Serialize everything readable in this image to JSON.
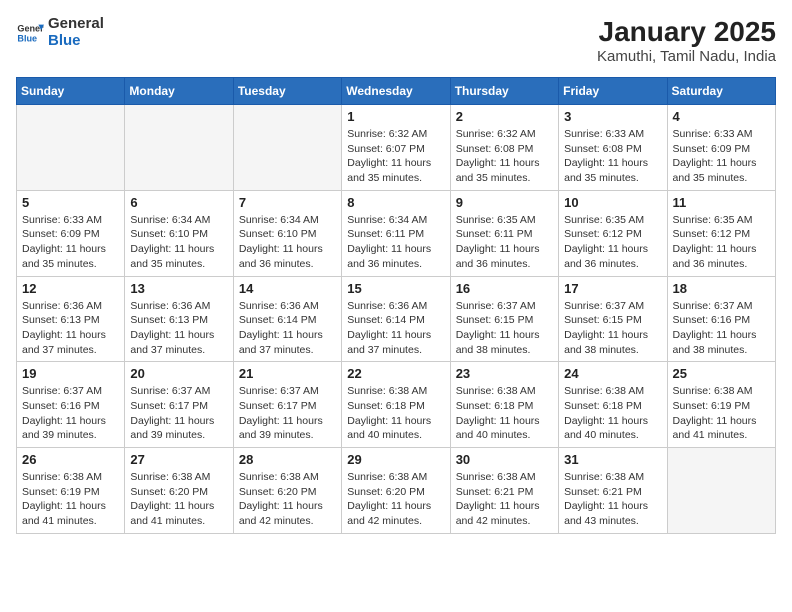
{
  "header": {
    "logo_line1": "General",
    "logo_line2": "Blue",
    "month": "January 2025",
    "location": "Kamuthi, Tamil Nadu, India"
  },
  "weekdays": [
    "Sunday",
    "Monday",
    "Tuesday",
    "Wednesday",
    "Thursday",
    "Friday",
    "Saturday"
  ],
  "weeks": [
    [
      {
        "day": "",
        "info": ""
      },
      {
        "day": "",
        "info": ""
      },
      {
        "day": "",
        "info": ""
      },
      {
        "day": "1",
        "info": "Sunrise: 6:32 AM\nSunset: 6:07 PM\nDaylight: 11 hours and 35 minutes."
      },
      {
        "day": "2",
        "info": "Sunrise: 6:32 AM\nSunset: 6:08 PM\nDaylight: 11 hours and 35 minutes."
      },
      {
        "day": "3",
        "info": "Sunrise: 6:33 AM\nSunset: 6:08 PM\nDaylight: 11 hours and 35 minutes."
      },
      {
        "day": "4",
        "info": "Sunrise: 6:33 AM\nSunset: 6:09 PM\nDaylight: 11 hours and 35 minutes."
      }
    ],
    [
      {
        "day": "5",
        "info": "Sunrise: 6:33 AM\nSunset: 6:09 PM\nDaylight: 11 hours and 35 minutes."
      },
      {
        "day": "6",
        "info": "Sunrise: 6:34 AM\nSunset: 6:10 PM\nDaylight: 11 hours and 35 minutes."
      },
      {
        "day": "7",
        "info": "Sunrise: 6:34 AM\nSunset: 6:10 PM\nDaylight: 11 hours and 36 minutes."
      },
      {
        "day": "8",
        "info": "Sunrise: 6:34 AM\nSunset: 6:11 PM\nDaylight: 11 hours and 36 minutes."
      },
      {
        "day": "9",
        "info": "Sunrise: 6:35 AM\nSunset: 6:11 PM\nDaylight: 11 hours and 36 minutes."
      },
      {
        "day": "10",
        "info": "Sunrise: 6:35 AM\nSunset: 6:12 PM\nDaylight: 11 hours and 36 minutes."
      },
      {
        "day": "11",
        "info": "Sunrise: 6:35 AM\nSunset: 6:12 PM\nDaylight: 11 hours and 36 minutes."
      }
    ],
    [
      {
        "day": "12",
        "info": "Sunrise: 6:36 AM\nSunset: 6:13 PM\nDaylight: 11 hours and 37 minutes."
      },
      {
        "day": "13",
        "info": "Sunrise: 6:36 AM\nSunset: 6:13 PM\nDaylight: 11 hours and 37 minutes."
      },
      {
        "day": "14",
        "info": "Sunrise: 6:36 AM\nSunset: 6:14 PM\nDaylight: 11 hours and 37 minutes."
      },
      {
        "day": "15",
        "info": "Sunrise: 6:36 AM\nSunset: 6:14 PM\nDaylight: 11 hours and 37 minutes."
      },
      {
        "day": "16",
        "info": "Sunrise: 6:37 AM\nSunset: 6:15 PM\nDaylight: 11 hours and 38 minutes."
      },
      {
        "day": "17",
        "info": "Sunrise: 6:37 AM\nSunset: 6:15 PM\nDaylight: 11 hours and 38 minutes."
      },
      {
        "day": "18",
        "info": "Sunrise: 6:37 AM\nSunset: 6:16 PM\nDaylight: 11 hours and 38 minutes."
      }
    ],
    [
      {
        "day": "19",
        "info": "Sunrise: 6:37 AM\nSunset: 6:16 PM\nDaylight: 11 hours and 39 minutes."
      },
      {
        "day": "20",
        "info": "Sunrise: 6:37 AM\nSunset: 6:17 PM\nDaylight: 11 hours and 39 minutes."
      },
      {
        "day": "21",
        "info": "Sunrise: 6:37 AM\nSunset: 6:17 PM\nDaylight: 11 hours and 39 minutes."
      },
      {
        "day": "22",
        "info": "Sunrise: 6:38 AM\nSunset: 6:18 PM\nDaylight: 11 hours and 40 minutes."
      },
      {
        "day": "23",
        "info": "Sunrise: 6:38 AM\nSunset: 6:18 PM\nDaylight: 11 hours and 40 minutes."
      },
      {
        "day": "24",
        "info": "Sunrise: 6:38 AM\nSunset: 6:18 PM\nDaylight: 11 hours and 40 minutes."
      },
      {
        "day": "25",
        "info": "Sunrise: 6:38 AM\nSunset: 6:19 PM\nDaylight: 11 hours and 41 minutes."
      }
    ],
    [
      {
        "day": "26",
        "info": "Sunrise: 6:38 AM\nSunset: 6:19 PM\nDaylight: 11 hours and 41 minutes."
      },
      {
        "day": "27",
        "info": "Sunrise: 6:38 AM\nSunset: 6:20 PM\nDaylight: 11 hours and 41 minutes."
      },
      {
        "day": "28",
        "info": "Sunrise: 6:38 AM\nSunset: 6:20 PM\nDaylight: 11 hours and 42 minutes."
      },
      {
        "day": "29",
        "info": "Sunrise: 6:38 AM\nSunset: 6:20 PM\nDaylight: 11 hours and 42 minutes."
      },
      {
        "day": "30",
        "info": "Sunrise: 6:38 AM\nSunset: 6:21 PM\nDaylight: 11 hours and 42 minutes."
      },
      {
        "day": "31",
        "info": "Sunrise: 6:38 AM\nSunset: 6:21 PM\nDaylight: 11 hours and 43 minutes."
      },
      {
        "day": "",
        "info": ""
      }
    ]
  ]
}
